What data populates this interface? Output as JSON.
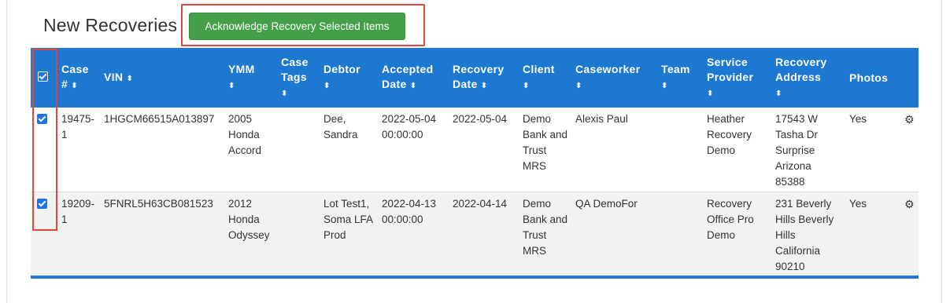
{
  "page": {
    "title": "New Recoveries",
    "acknowledge_button": "Acknowledge Recovery Selected Items"
  },
  "colors": {
    "header_bg": "#1c78d0",
    "button_bg": "#43a047",
    "annotation": "#e0473f"
  },
  "table": {
    "columns": [
      {
        "label": "Case #",
        "sort_icon": "⬍"
      },
      {
        "label": "VIN",
        "sort_icon": "⬍"
      },
      {
        "label": "YMM",
        "sort_icon": "⬍"
      },
      {
        "label": "Case Tags",
        "sort_icon": "⬍"
      },
      {
        "label": "Debtor",
        "sort_icon": "⬍"
      },
      {
        "label": "Accepted Date",
        "sort_icon": "⬍"
      },
      {
        "label": "Recovery Date",
        "sort_icon": "⬍"
      },
      {
        "label": "Client",
        "sort_icon": "⬍"
      },
      {
        "label": "Caseworker",
        "sort_icon": "⬍"
      },
      {
        "label": "Team",
        "sort_icon": "⬍"
      },
      {
        "label": "Service Provider",
        "sort_icon": "⬍"
      },
      {
        "label": "Recovery Address",
        "sort_icon": "⬍"
      },
      {
        "label": "Photos",
        "sort_icon": ""
      }
    ],
    "rows": [
      {
        "checked": true,
        "case": "19475-1",
        "vin": "1HGCM66515A013897",
        "ymm": "2005 Honda Accord",
        "case_tags": "",
        "debtor": "Dee, Sandra",
        "accepted_date": "2022-05-04 00:00:00",
        "recovery_date": "2022-05-04",
        "client": "Demo Bank and Trust MRS",
        "caseworker": "Alexis Paul",
        "team": "",
        "service_provider": "Heather Recovery Demo",
        "recovery_address": "17543 W Tasha Dr Surprise Arizona 85388",
        "photos": "Yes",
        "action_icon": "gear-icon"
      },
      {
        "checked": true,
        "case": "19209-1",
        "vin": "5FNRL5H63CB081523",
        "ymm": "2012 Honda Odyssey",
        "case_tags": "",
        "debtor": "Lot Test1, Soma LFA Prod",
        "accepted_date": "2022-04-13 00:00:00",
        "recovery_date": "2022-04-14",
        "client": "Demo Bank and Trust MRS",
        "caseworker": "QA DemoFor",
        "team": "",
        "service_provider": "Recovery Office Pro Demo",
        "recovery_address": "231 Beverly Hills Beverly Hills California 90210",
        "photos": "Yes",
        "action_icon": "gear-icon"
      }
    ]
  }
}
